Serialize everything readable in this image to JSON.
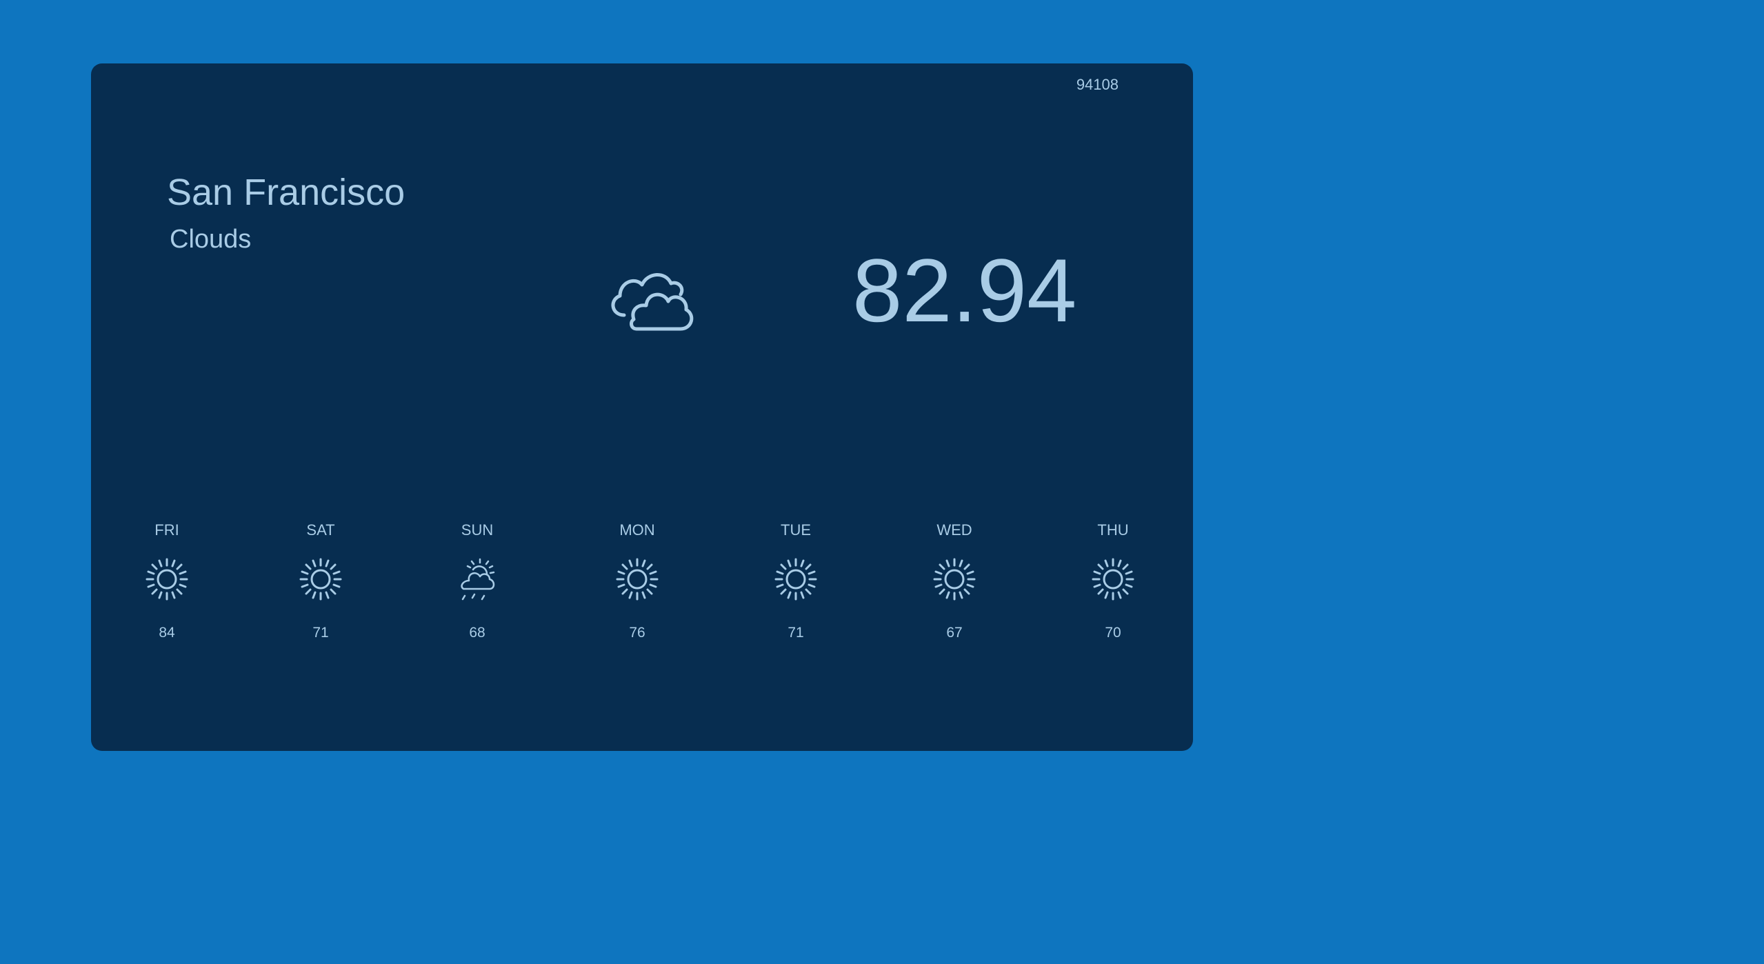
{
  "location": {
    "zip": "94108",
    "city": "San Francisco",
    "conditions": "Clouds",
    "temperature": "82.94",
    "icon": "clouds-icon"
  },
  "forecast": [
    {
      "day": "FRI",
      "icon": "sun-icon",
      "temp": "84"
    },
    {
      "day": "SAT",
      "icon": "sun-icon",
      "temp": "71"
    },
    {
      "day": "SUN",
      "icon": "partly-cloudy-rain-icon",
      "temp": "68"
    },
    {
      "day": "MON",
      "icon": "sun-icon",
      "temp": "76"
    },
    {
      "day": "TUE",
      "icon": "sun-icon",
      "temp": "71"
    },
    {
      "day": "WED",
      "icon": "sun-icon",
      "temp": "67"
    },
    {
      "day": "THU",
      "icon": "sun-icon",
      "temp": "70"
    }
  ],
  "colors": {
    "page_background": "#0e75bf",
    "card_background": "#072d50",
    "text": "#a9cce6"
  }
}
